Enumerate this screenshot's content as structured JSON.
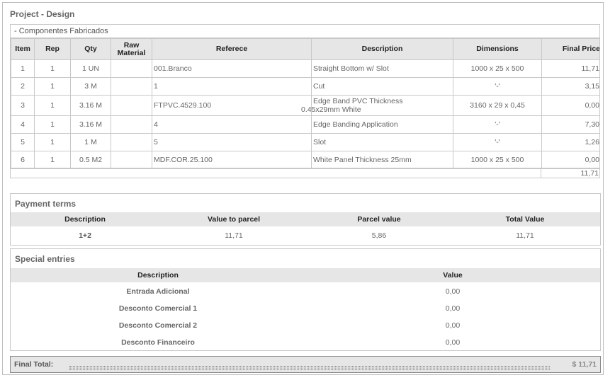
{
  "page": {
    "title": "Project - Design"
  },
  "components": {
    "label": "- Componentes Fabricados",
    "columns": [
      "Item",
      "Rep",
      "Qty",
      "Raw Material",
      "Referece",
      "Description",
      "Dimensions",
      "Final Price"
    ],
    "rows": [
      {
        "item": "1",
        "rep": "1",
        "qty": "1 UN",
        "raw": "",
        "ref": "001.Branco",
        "desc": "Straight Bottom w/ Slot",
        "dim": "1000 x 25 x 500",
        "price": "11,71"
      },
      {
        "item": "2",
        "rep": "1",
        "qty": "3 M",
        "raw": "",
        "ref": "1",
        "desc": "Cut",
        "dim": "'-'",
        "price": "3,15"
      },
      {
        "item": "3",
        "rep": "1",
        "qty": "3.16 M",
        "raw": "",
        "ref": "FTPVC.4529.100",
        "desc_line1": "Edge Band PVC Thickness",
        "desc_line2": "0.45x29mm White",
        "dim": "3160 x 29 x 0,45",
        "price": "0,00"
      },
      {
        "item": "4",
        "rep": "1",
        "qty": "3.16 M",
        "raw": "",
        "ref": "4",
        "desc": "Edge Banding Application",
        "dim": "'-'",
        "price": "7,30"
      },
      {
        "item": "5",
        "rep": "1",
        "qty": "1 M",
        "raw": "",
        "ref": "5",
        "desc": "Slot",
        "dim": "'-'",
        "price": "1,26"
      },
      {
        "item": "6",
        "rep": "1",
        "qty": "0.5 M2",
        "raw": "",
        "ref": "MDF.COR.25.100",
        "desc": "White Panel Thickness 25mm",
        "dim": "1000 x 25 x 500",
        "price": "0,00"
      }
    ],
    "total": "11,71"
  },
  "payment": {
    "title": "Payment terms",
    "columns": [
      "Description",
      "Value to parcel",
      "Parcel value",
      "Total Value"
    ],
    "row": {
      "description": "1+2",
      "value_to_parcel": "11,71",
      "parcel_value": "5,86",
      "total_value": "11,71"
    }
  },
  "special": {
    "title": "Special entries",
    "columns": [
      "Description",
      "Value"
    ],
    "rows": [
      {
        "description": "Entrada Adicional",
        "value": "0,00"
      },
      {
        "description": "Desconto Comercial 1",
        "value": "0,00"
      },
      {
        "description": "Desconto Comercial 2",
        "value": "0,00"
      },
      {
        "description": "Desconto Financeiro",
        "value": "0,00"
      }
    ]
  },
  "final": {
    "label": "Final Total:",
    "value": "$ 11,71"
  }
}
